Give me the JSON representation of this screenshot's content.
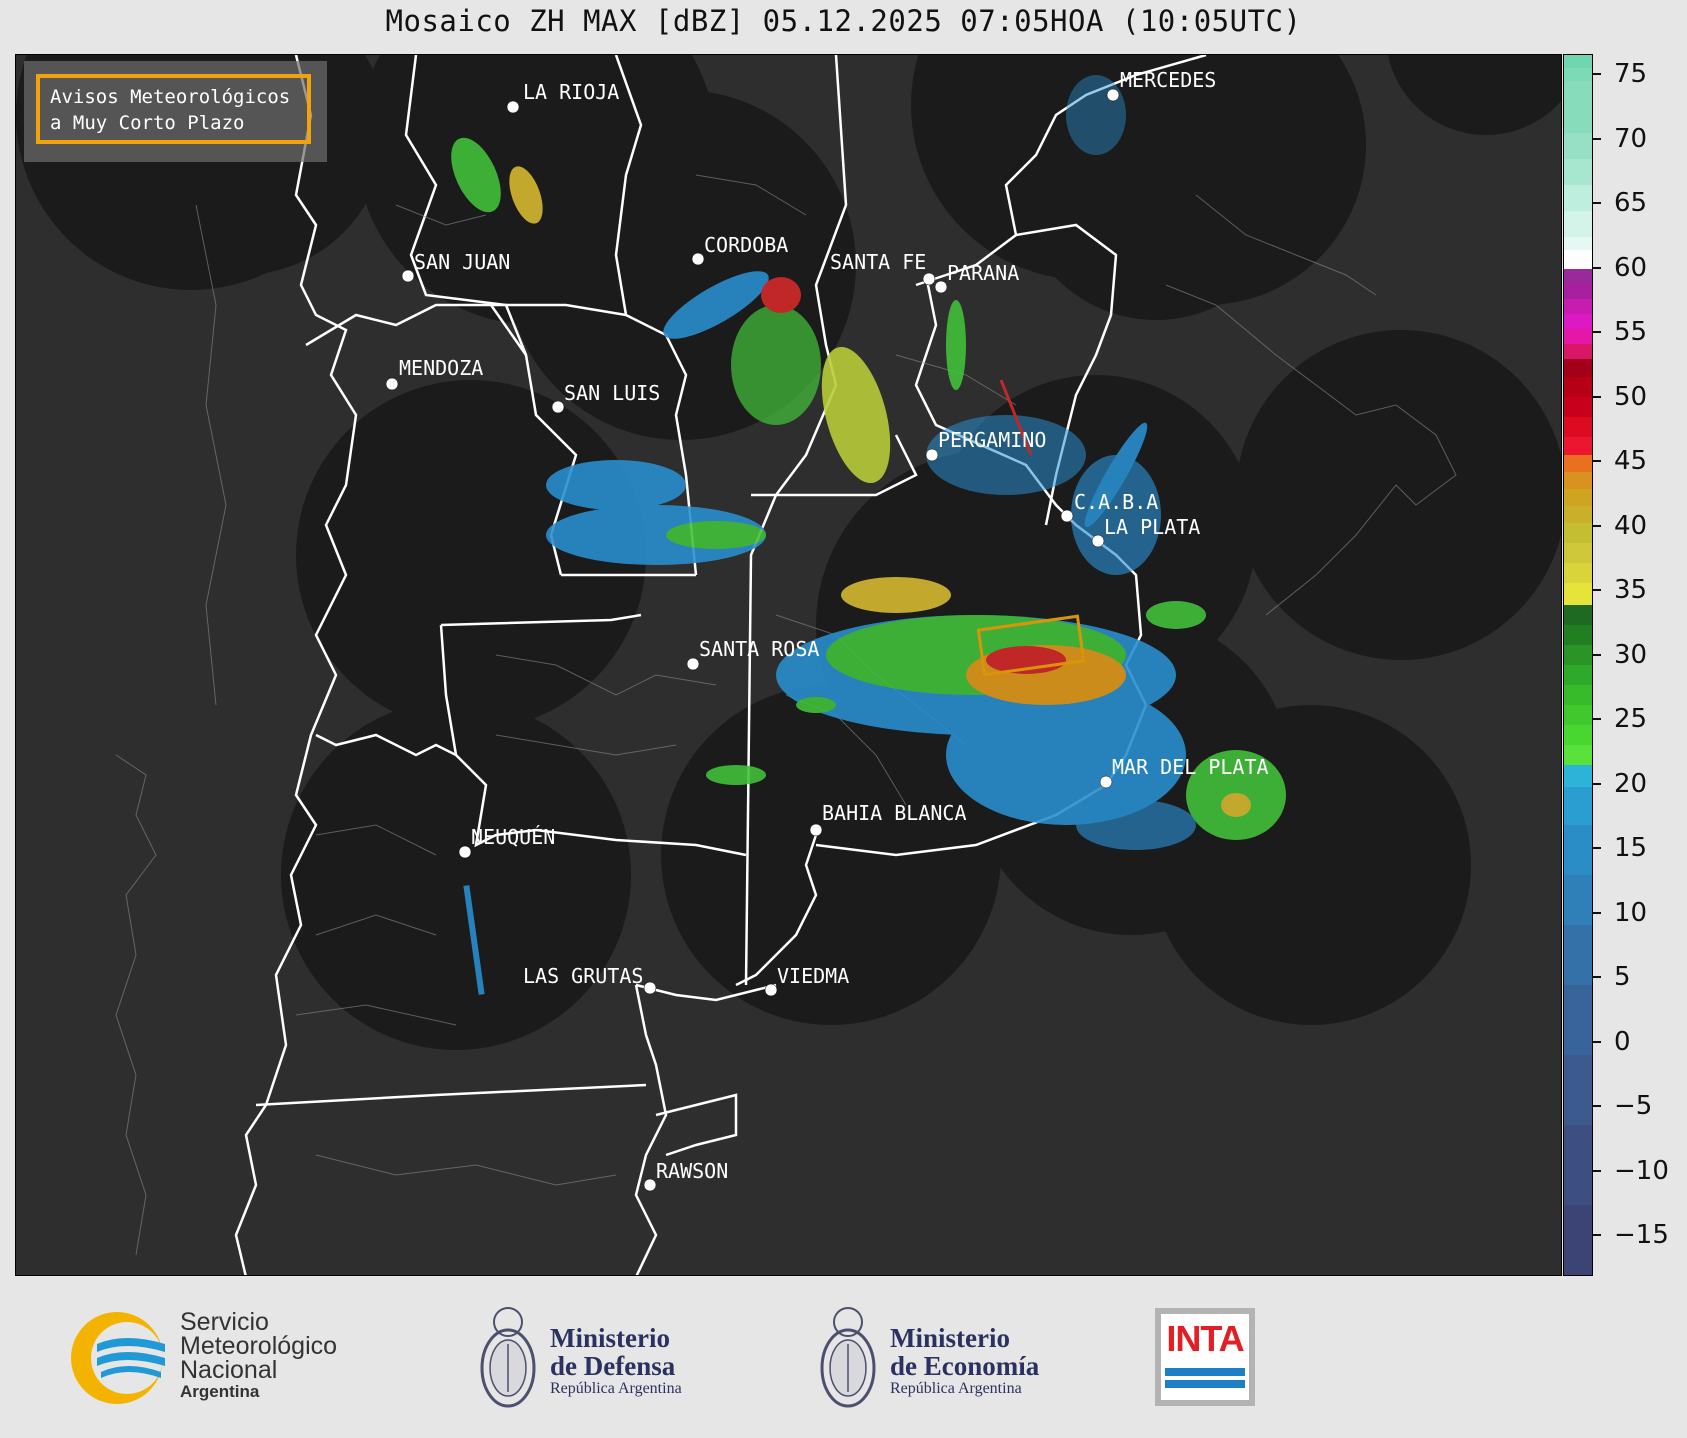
{
  "title": "Mosaico ZH MAX [dBZ] 05.12.2025 07:05HOA (10:05UTC)",
  "notice": {
    "line1": "Avisos Meteorológicos",
    "line2": "a Muy Corto Plazo"
  },
  "cities": [
    {
      "name": "LA RIOJA"
    },
    {
      "name": "SAN JUAN"
    },
    {
      "name": "CORDOBA"
    },
    {
      "name": "SANTA FE"
    },
    {
      "name": "PARANA"
    },
    {
      "name": "MENDOZA"
    },
    {
      "name": "SAN LUIS"
    },
    {
      "name": "PERGAMINO"
    },
    {
      "name": "MERCEDES"
    },
    {
      "name": "C.A.B.A"
    },
    {
      "name": "LA PLATA"
    },
    {
      "name": "SANTA ROSA"
    },
    {
      "name": "MAR DEL PLATA"
    },
    {
      "name": "BAHIA BLANCA"
    },
    {
      "name": "NEUQUÉN"
    },
    {
      "name": "LAS GRUTAS"
    },
    {
      "name": "VIEDMA"
    },
    {
      "name": "RAWSON"
    }
  ],
  "colorbar": {
    "ticks": [
      "75",
      "70",
      "65",
      "60",
      "55",
      "50",
      "45",
      "40",
      "35",
      "30",
      "25",
      "20",
      "15",
      "10",
      "5",
      "0",
      "−5",
      "−10",
      "−15"
    ]
  },
  "logos": {
    "smn": {
      "line1": "Servicio",
      "line2": "Meteorológico",
      "line3": "Nacional",
      "sub": "Argentina"
    },
    "defensa": {
      "line1": "Ministerio",
      "line2": "de Defensa",
      "sub": "República Argentina"
    },
    "economia": {
      "line1": "Ministerio",
      "line2": "de Economía",
      "sub": "República Argentina"
    },
    "inta": {
      "label": "INTA"
    }
  },
  "colors": {
    "map_bg": "#2e2e2e",
    "radar_disc": "#1c1c1c",
    "notice_border": "#f0a30a"
  }
}
